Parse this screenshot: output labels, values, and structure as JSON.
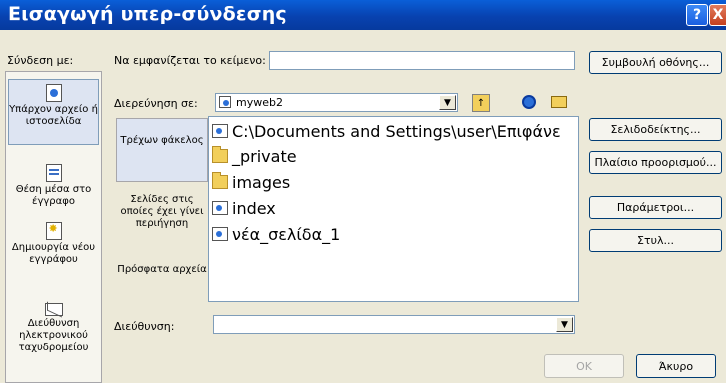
{
  "dialog": {
    "title": "Εισαγωγή υπερ-σύνδεσης",
    "help_label": "?",
    "close_label": "X"
  },
  "link_to": {
    "label": "Σύνδεση με:",
    "items": [
      {
        "label": "Υπάρχον αρχείο ή ιστοσελίδα",
        "icon": "existing-file-icon"
      },
      {
        "label": "Θέση μέσα στο έγγραφο",
        "icon": "place-in-document-icon"
      },
      {
        "label": "Δημιουργία νέου εγγράφου",
        "icon": "new-document-icon"
      },
      {
        "label": "Διεύθυνση ηλεκτρονικού ταχυδρομείου",
        "icon": "email-icon"
      }
    ]
  },
  "text_to_display": {
    "label": "Να εμφανίζεται το κείμενο:",
    "value": ""
  },
  "screentip_button": "Συμβουλή οθόνης...",
  "look_in": {
    "label": "Διερεύνηση σε:",
    "value": "myweb2"
  },
  "look_in_pane": [
    {
      "label": "Τρέχων φάκελος"
    },
    {
      "label": "Σελίδες στις οποίες έχει γίνει περιήγηση"
    },
    {
      "label": "Πρόσφατα αρχεία"
    }
  ],
  "files": [
    {
      "name": "C:\\Documents and Settings\\user\\Επιφάνε",
      "icon": "web-page-icon"
    },
    {
      "name": "_private",
      "icon": "folder-icon"
    },
    {
      "name": "images",
      "icon": "folder-icon"
    },
    {
      "name": "index",
      "icon": "web-page-icon"
    },
    {
      "name": "νέα_σελίδα_1",
      "icon": "web-page-icon"
    }
  ],
  "side_buttons": [
    "Σελιδοδείκτης...",
    "Πλαίσιο προορισμού...",
    "Παράμετροι...",
    "Στυλ..."
  ],
  "address": {
    "label": "Διεύθυνση:",
    "value": ""
  },
  "ok_button": "OK",
  "cancel_button": "Άκυρο"
}
